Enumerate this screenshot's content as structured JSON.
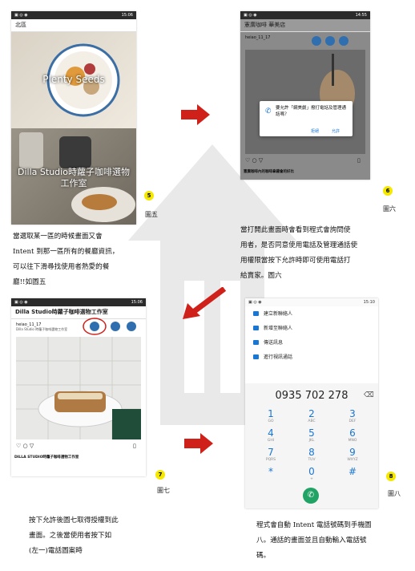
{
  "fig5": {
    "status_time": "15:06",
    "app_title": "北區",
    "card1_title": "Plenty Seeds",
    "card2_title": "Dilla Studio時蘿子咖啡選物工作室",
    "badge": "5",
    "label": "圖五",
    "text": [
      "當選取某一區的時候畫面又會",
      "Intent 到那一區所有的餐廳資訊，",
      "可以往下滑尋找使用者熱愛的餐",
      "廳!!如圖五"
    ]
  },
  "fig6": {
    "status_time": "14:55",
    "app_title": "憲廣咖啡 華美店",
    "user": "heiao_11_17",
    "dialog_text": "要允許「網美劇」撥打電話及管理通話嗎？",
    "deny": "拒絕",
    "allow": "允許",
    "bottom_caption": "憲廣咖啡內的咖啡拿鐵會的好比",
    "badge": "6",
    "label": "圖六",
    "text": [
      "當打開此畫面時會看到程式會詢問使",
      "用者，是否同意使用電話及管理通話使",
      "用權限當按下允許時即可使用電話打",
      "給賣家。圖六"
    ]
  },
  "fig7": {
    "status_time": "15:06",
    "app_title": "Dilla Studio時蘿子咖啡選物工作室",
    "user": "heiao_11_17",
    "user_sub": "Dilla Studio 時蘿子咖啡選物工作室",
    "bottom_caption": "DILLA STUDIO時蘿子咖啡選物工作室",
    "badge": "7",
    "label": "圖七",
    "text": [
      "按下允許後圖七取得授權到此",
      "畫面。之後當使用者按下如",
      "(左一)電話圖案時"
    ]
  },
  "fig8": {
    "status_time": "15:10",
    "menu": [
      "建立新聯絡人",
      "新增至聯絡人",
      "傳送訊息",
      "進行視訊通話"
    ],
    "number": "0935 702 278",
    "keys": [
      {
        "n": "1",
        "l": "GO"
      },
      {
        "n": "2",
        "l": "ABC"
      },
      {
        "n": "3",
        "l": "DEF"
      },
      {
        "n": "4",
        "l": "GHI"
      },
      {
        "n": "5",
        "l": "JKL"
      },
      {
        "n": "6",
        "l": "MNO"
      },
      {
        "n": "7",
        "l": "PQRS"
      },
      {
        "n": "8",
        "l": "TUV"
      },
      {
        "n": "9",
        "l": "WXYZ"
      },
      {
        "n": "*",
        "l": ""
      },
      {
        "n": "0",
        "l": "+"
      },
      {
        "n": "#",
        "l": ""
      }
    ],
    "badge": "8",
    "label": "圖八",
    "text": [
      "程式會自動 Intent 電話號碼到手機圖",
      "八。通話的畫面並且自動輸入電話號",
      "碼。"
    ]
  },
  "colors": {
    "accent_red": "#d0201a",
    "badge_yellow": "#f5e800",
    "dial_blue": "#1976d2",
    "call_green": "#21a366"
  }
}
